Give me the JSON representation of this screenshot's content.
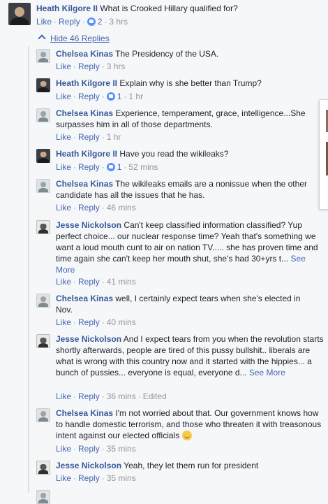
{
  "root": {
    "author": "Heath Kilgore II",
    "text": "What is Crooked Hillary qualified for?",
    "like": "Like",
    "reply": "Reply",
    "likes": "2",
    "time": "3 hrs"
  },
  "hide_replies": "Hide 46 Replies",
  "replies": [
    {
      "author": "Chelsea Kinas",
      "text": "The Presidency of the USA.",
      "like": "Like",
      "reply": "Reply",
      "likes": "",
      "time": "3 hrs"
    },
    {
      "author": "Heath Kilgore II",
      "text": "Explain why is she better than Trump?",
      "like": "Like",
      "reply": "Reply",
      "likes": "1",
      "time": "1 hr"
    },
    {
      "author": "Chelsea Kinas",
      "text": "Experience, temperament, grace, intelligence...She surpasses him in all of those departments.",
      "like": "Like",
      "reply": "Reply",
      "likes": "",
      "time": "1 hr"
    },
    {
      "author": "Heath Kilgore II",
      "text": "Have you read the wikileaks?",
      "like": "Like",
      "reply": "Reply",
      "likes": "1",
      "time": "52 mins"
    },
    {
      "author": "Chelsea Kinas",
      "text": "The wikileaks emails are a nonissue when the other candidate has all the issues that he has.",
      "like": "Like",
      "reply": "Reply",
      "likes": "",
      "time": "46 mins"
    },
    {
      "author": "Jesse Nickolson",
      "text": "Can't keep classified information classified? Yup perfect choice... our nuclear response time? Yeah that's something we want a loud mouth cunt to air on nation TV..... she has proven time and time again she can't keep her mouth shut, she's had 30+yrs t...",
      "see_more": "See More",
      "like": "Like",
      "reply": "Reply",
      "likes": "",
      "time": "41 mins"
    },
    {
      "author": "Chelsea Kinas",
      "text": "well, I certainly expect tears when she's elected in Nov.",
      "like": "Like",
      "reply": "Reply",
      "likes": "",
      "time": "40 mins"
    },
    {
      "author": "Jesse Nickolson",
      "text": "And I expect tears from you when the revolution starts shortly afterwards, people are tired of this pussy bullshit.. liberals are what is wrong with this country now and it started with the hippies... a bunch of pussies... everyone is equal, everyone d...",
      "see_more": "See More",
      "like": "Like",
      "reply": "Reply",
      "likes": "",
      "time": "36 mins",
      "edited": "Edited"
    },
    {
      "author": "Chelsea Kinas",
      "text": "I'm not worried about that. Our government knows how to handle domestic terrorism, and those who threaten it with treasonous intent against our elected officials",
      "emoji": "smile",
      "like": "Like",
      "reply": "Reply",
      "likes": "",
      "time": "35 mins"
    },
    {
      "author": "Jesse Nickolson",
      "text": "Yeah, they let them run for president",
      "like": "Like",
      "reply": "Reply",
      "likes": "",
      "time": "35 mins"
    }
  ]
}
